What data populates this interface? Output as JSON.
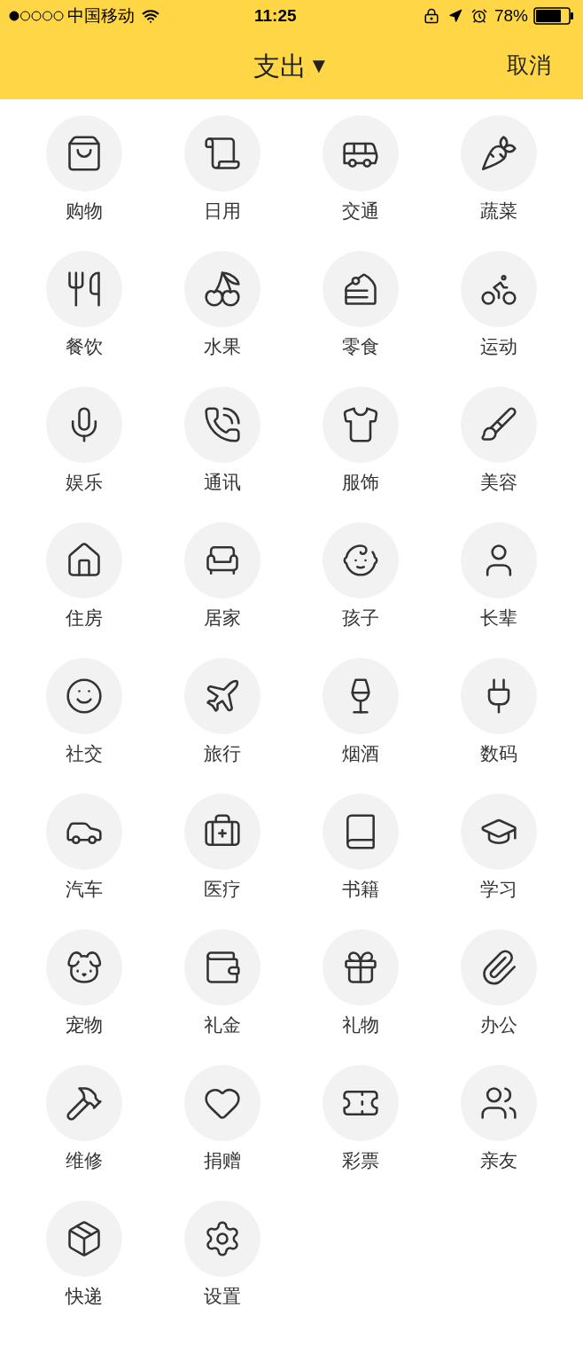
{
  "status_bar": {
    "carrier": "中国移动",
    "time": "11:25",
    "battery": "78%"
  },
  "header": {
    "title": "支出",
    "dropdown": "▼",
    "cancel": "取消"
  },
  "categories": [
    {
      "label": "购物"
    },
    {
      "label": "日用"
    },
    {
      "label": "交通"
    },
    {
      "label": "蔬菜"
    },
    {
      "label": "餐饮"
    },
    {
      "label": "水果"
    },
    {
      "label": "零食"
    },
    {
      "label": "运动"
    },
    {
      "label": "娱乐"
    },
    {
      "label": "通讯"
    },
    {
      "label": "服饰"
    },
    {
      "label": "美容"
    },
    {
      "label": "住房"
    },
    {
      "label": "居家"
    },
    {
      "label": "孩子"
    },
    {
      "label": "长辈"
    },
    {
      "label": "社交"
    },
    {
      "label": "旅行"
    },
    {
      "label": "烟酒"
    },
    {
      "label": "数码"
    },
    {
      "label": "汽车"
    },
    {
      "label": "医疗"
    },
    {
      "label": "书籍"
    },
    {
      "label": "学习"
    },
    {
      "label": "宠物"
    },
    {
      "label": "礼金"
    },
    {
      "label": "礼物"
    },
    {
      "label": "办公"
    },
    {
      "label": "维修"
    },
    {
      "label": "捐赠"
    },
    {
      "label": "彩票"
    },
    {
      "label": "亲友"
    },
    {
      "label": "快递"
    },
    {
      "label": "设置"
    }
  ]
}
